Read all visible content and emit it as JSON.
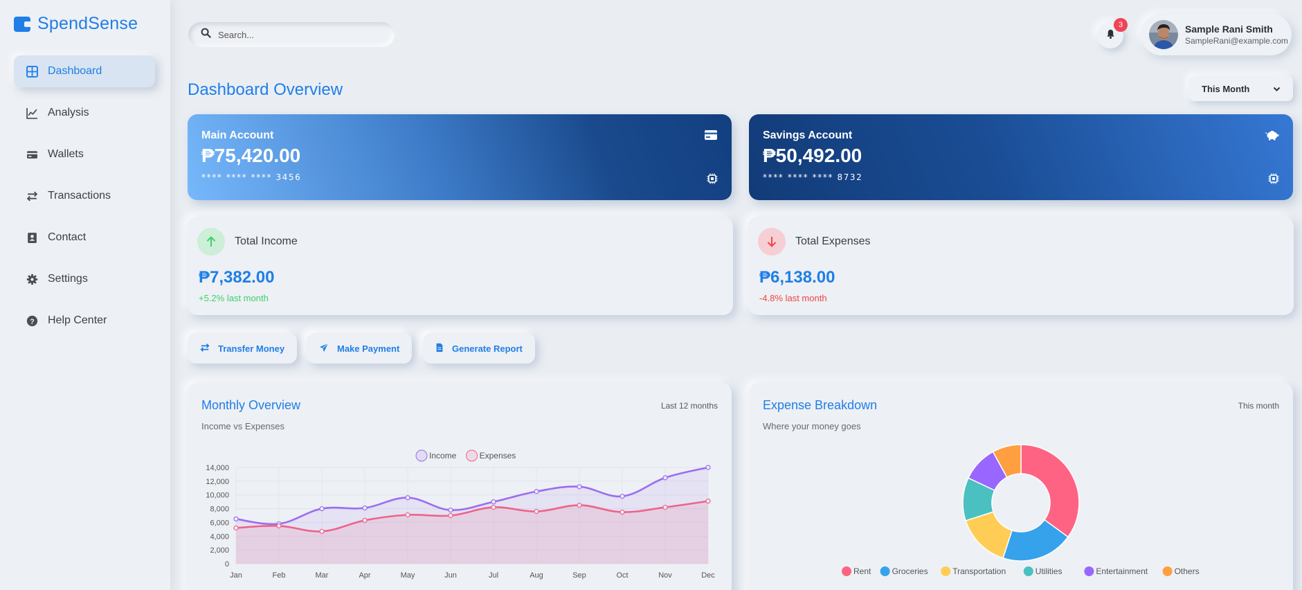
{
  "app": {
    "name": "SpendSense",
    "accent": "#1f7ee8"
  },
  "sidebar": {
    "items": [
      {
        "label": "Dashboard",
        "icon": "grid-icon",
        "active": true
      },
      {
        "label": "Analysis",
        "icon": "chart-line-icon"
      },
      {
        "label": "Wallets",
        "icon": "wallet-icon"
      },
      {
        "label": "Transactions",
        "icon": "exchange-icon"
      },
      {
        "label": "Contact",
        "icon": "contact-book-icon"
      },
      {
        "label": "Settings",
        "icon": "gear-icon"
      },
      {
        "label": "Help Center",
        "icon": "question-circle-icon"
      }
    ]
  },
  "header": {
    "search_placeholder": "Search...",
    "notifications_count": "3",
    "user": {
      "name": "Sample Rani Smith",
      "email": "SampleRani@example.com"
    }
  },
  "page": {
    "title": "Dashboard Overview",
    "period": "This Month"
  },
  "accounts": {
    "main": {
      "label": "Main Account",
      "balance": "₱75,420.00",
      "number": "**** **** **** 3456",
      "icon": "credit-card-icon"
    },
    "savings": {
      "label": "Savings Account",
      "balance": "₱50,492.00",
      "number": "**** **** **** 8732",
      "icon": "piggy-bank-icon"
    }
  },
  "stats": {
    "income": {
      "label": "Total Income",
      "value": "₱7,382.00",
      "change": "+5.2% last month",
      "color": "#3ecf6e"
    },
    "expenses": {
      "label": "Total Expenses",
      "value": "₱6,138.00",
      "change": "-4.8% last month",
      "color": "#ef4444"
    }
  },
  "actions": {
    "transfer": "Transfer Money",
    "payment": "Make Payment",
    "report": "Generate Report"
  },
  "monthly": {
    "title": "Monthly Overview",
    "subtitle": "Income vs Expenses",
    "range": "Last 12 months"
  },
  "breakdown": {
    "title": "Expense Breakdown",
    "subtitle": "Where your money goes",
    "range": "This month"
  },
  "chart_data": [
    {
      "type": "line",
      "categories": [
        "Jan",
        "Feb",
        "Mar",
        "Apr",
        "May",
        "Jun",
        "Jul",
        "Aug",
        "Sep",
        "Oct",
        "Nov",
        "Dec"
      ],
      "ylim": [
        0,
        14000
      ],
      "yticks": [
        "0",
        "2,000",
        "4,000",
        "6,000",
        "8,000",
        "10,000",
        "12,000",
        "14,000"
      ],
      "legend": "top",
      "series": [
        {
          "name": "Income",
          "color": "#9b6cf0",
          "values": [
            6500,
            5800,
            8000,
            8100,
            9600,
            7800,
            9000,
            10500,
            11200,
            9800,
            12500,
            14000
          ]
        },
        {
          "name": "Expenses",
          "color": "#ee6389",
          "values": [
            5200,
            5500,
            4700,
            6300,
            7100,
            7000,
            8200,
            7600,
            8500,
            7500,
            8200,
            9100
          ]
        }
      ]
    },
    {
      "type": "pie",
      "legend": "bottom",
      "slices": [
        {
          "label": "Rent",
          "value": 35,
          "color": "#ff6384"
        },
        {
          "label": "Groceries",
          "value": 20,
          "color": "#36a2eb"
        },
        {
          "label": "Transportation",
          "value": 15,
          "color": "#ffcd56"
        },
        {
          "label": "Utilities",
          "value": 12,
          "color": "#4bc0c0"
        },
        {
          "label": "Entertainment",
          "value": 10,
          "color": "#9966ff"
        },
        {
          "label": "Others",
          "value": 8,
          "color": "#ff9f40"
        }
      ]
    }
  ]
}
